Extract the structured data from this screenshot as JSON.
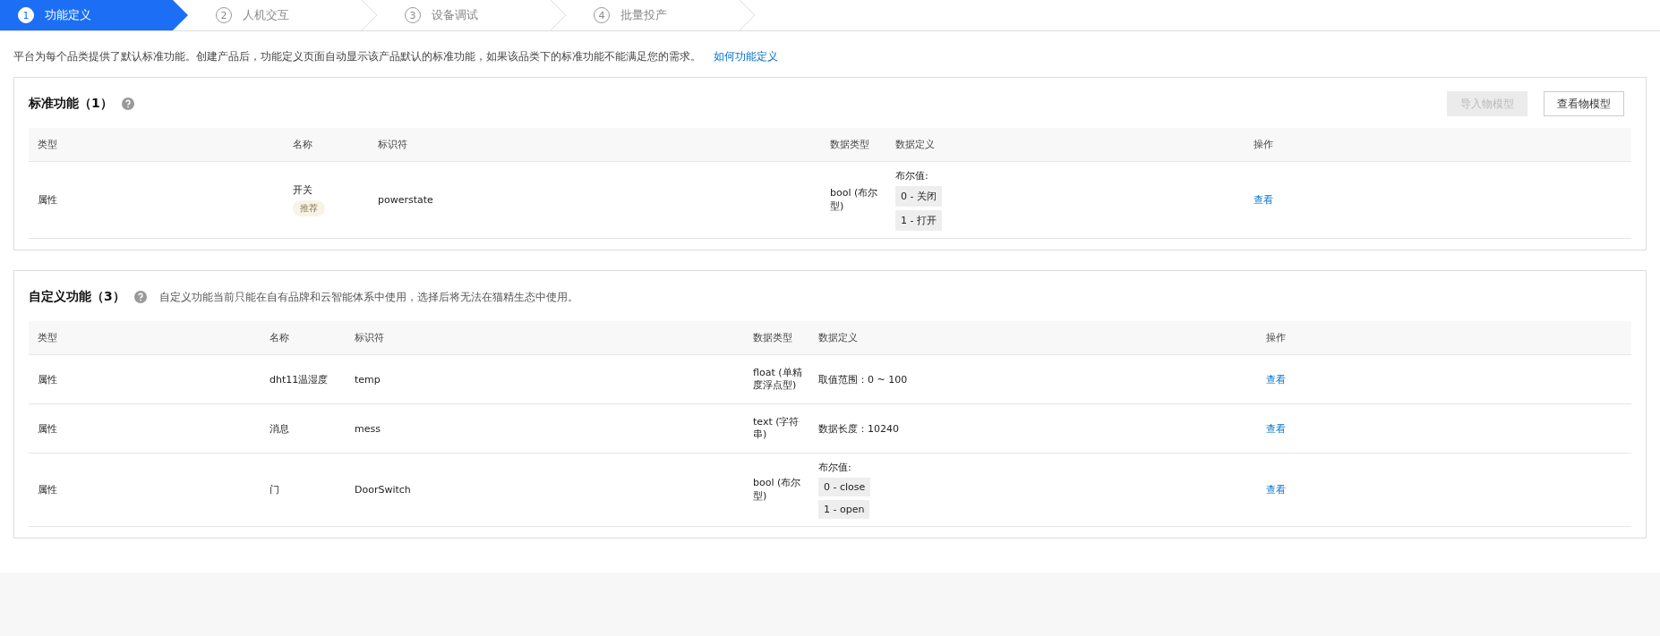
{
  "steps": [
    {
      "number": "1",
      "label": "功能定义",
      "selected": true
    },
    {
      "number": "2",
      "label": "人机交互",
      "selected": false
    },
    {
      "number": "3",
      "label": "设备调试",
      "selected": false
    },
    {
      "number": "4",
      "label": "批量投产",
      "selected": false
    }
  ],
  "intro": {
    "text": "平台为每个品类提供了默认标准功能。创建产品后，功能定义页面自动显示该产品默认的标准功能，如果该品类下的标准功能不能满足您的需求。",
    "link": "如何功能定义"
  },
  "sections": [
    {
      "title": "标准功能（1）",
      "buttons": [
        {
          "label": "导入物模型",
          "disabled": true
        },
        {
          "label": "查看物模型",
          "disabled": false
        }
      ],
      "columns": [
        "类型",
        "名称",
        "标识符",
        "数据类型",
        "数据定义",
        "操作"
      ],
      "rows": [
        {
          "type": "属性",
          "name": "开关",
          "badge": "推荐",
          "identifier": "powerstate",
          "data_type": "bool (布尔型)",
          "definition": {
            "kind": "enum",
            "label": "布尔值:",
            "values": [
              "0 - 关闭",
              "1 - 打开"
            ]
          },
          "action": "查看"
        }
      ]
    },
    {
      "title": "自定义功能（3）",
      "note": "自定义功能当前只能在自有品牌和云智能体系中使用，选择后将无法在猫精生态中使用。",
      "columns": [
        "类型",
        "名称",
        "标识符",
        "数据类型",
        "数据定义",
        "操作"
      ],
      "rows": [
        {
          "type": "属性",
          "name": "dht11温湿度",
          "identifier": "temp",
          "data_type": "float (单精度浮点型)",
          "definition": {
            "kind": "text",
            "text": "取值范围：0 ~ 100"
          },
          "action": "查看"
        },
        {
          "type": "属性",
          "name": "消息",
          "identifier": "mess",
          "data_type": "text (字符串)",
          "definition": {
            "kind": "text",
            "text": "数据长度：10240"
          },
          "action": "查看"
        },
        {
          "type": "属性",
          "name": "门",
          "identifier": "DoorSwitch",
          "data_type": "bool (布尔型)",
          "definition": {
            "kind": "enum",
            "label": "布尔值:",
            "values": [
              "0 - close",
              "1 - open"
            ]
          },
          "action": "查看"
        }
      ]
    }
  ]
}
